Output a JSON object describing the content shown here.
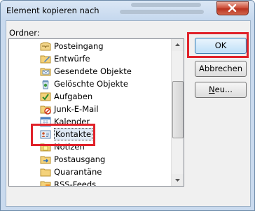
{
  "window": {
    "title": "Element kopieren nach"
  },
  "folder_label": "Ordner:",
  "folders": [
    {
      "label": "Posteingang",
      "icon": "inbox-icon"
    },
    {
      "label": "Entwürfe",
      "icon": "drafts-icon"
    },
    {
      "label": "Gesendete Objekte",
      "icon": "sent-items-icon"
    },
    {
      "label": "Gelöschte Objekte",
      "icon": "deleted-items-icon"
    },
    {
      "label": "Aufgaben",
      "icon": "tasks-icon"
    },
    {
      "label": "Junk-E-Mail",
      "icon": "junk-mail-icon"
    },
    {
      "label": "Kalender",
      "icon": "calendar-icon"
    },
    {
      "label": "Kontakte",
      "icon": "contacts-icon",
      "selected": true
    },
    {
      "label": "Notizen",
      "icon": "notes-icon"
    },
    {
      "label": "Postausgang",
      "icon": "outbox-icon"
    },
    {
      "label": "Quarantäne",
      "icon": "folder-icon"
    },
    {
      "label": "RSS-Feeds",
      "icon": "rss-feeds-icon"
    }
  ],
  "buttons": {
    "ok": "OK",
    "cancel": "Abbrechen",
    "new_prefix": "",
    "new_underlined": "N",
    "new_suffix": "eu..."
  },
  "colors": {
    "highlight": "#e0222a",
    "close_button": "#c8412c",
    "titlebar": "#c9daee"
  }
}
